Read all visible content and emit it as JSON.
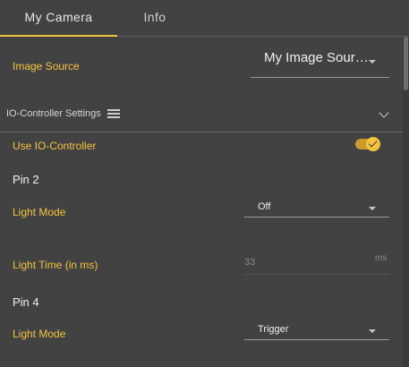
{
  "tabs": {
    "camera": "My Camera",
    "info": "Info"
  },
  "image_source": {
    "label": "Image Source",
    "value": "My Image Sour…"
  },
  "io_section": {
    "title": "IO-Controller Settings",
    "list_icon": "list-icon",
    "toggle_icon": "chevron-down-icon"
  },
  "use_io": {
    "label": "Use IO-Controller",
    "enabled": true
  },
  "pin2": {
    "heading": "Pin 2",
    "light_mode_label": "Light Mode",
    "light_mode_value": "Off",
    "light_time_label": "Light Time (in ms)",
    "light_time_value": "33",
    "light_time_unit": "ms"
  },
  "pin4": {
    "heading": "Pin 4",
    "light_mode_label": "Light Mode",
    "light_mode_value": "Trigger"
  },
  "colors": {
    "background": "#424242",
    "accent": "#f5c342",
    "text": "#f0f0f0"
  }
}
